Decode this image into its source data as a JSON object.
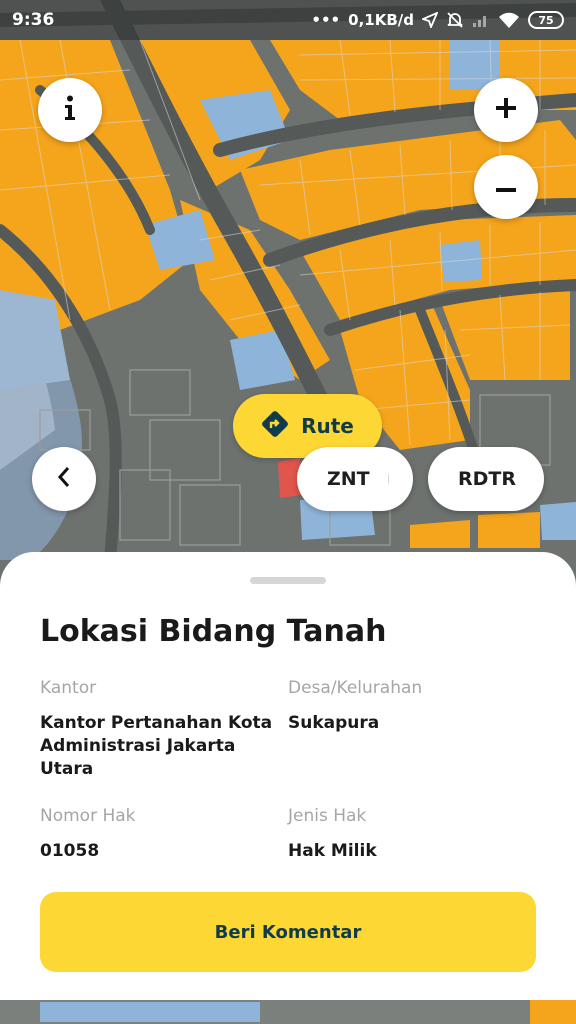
{
  "status_bar": {
    "time": "9:36",
    "dots": "•••",
    "network_speed": "0,1KB/d",
    "battery": "75"
  },
  "map": {
    "icons": [
      "info-icon",
      "plus-icon",
      "minus-icon",
      "chevron-left-icon",
      "route-icon"
    ],
    "colors": {
      "parcel_owned": "#f4a51c",
      "parcel_other": "#8fb4d9",
      "parcel_selected": "#e0564c",
      "road": "#555a58",
      "ground": "#6f7370"
    }
  },
  "controls": {
    "route_label": "Rute",
    "znt_label": "ZNT",
    "rdtr_label": "RDTR"
  },
  "sheet": {
    "title": "Lokasi Bidang Tanah",
    "kantor_label": "Kantor",
    "kantor_value": "Kantor Pertanahan Kota Administrasi Jakarta Utara",
    "desa_label": "Desa/Kelurahan",
    "desa_value": "Sukapura",
    "nomor_label": "Nomor Hak",
    "nomor_value": "01058",
    "jenis_label": "Jenis Hak",
    "jenis_value": "Hak Milik",
    "button_label": "Beri Komentar"
  },
  "colors": {
    "accent": "#fdd835",
    "accent_text": "#0f3b4a"
  }
}
